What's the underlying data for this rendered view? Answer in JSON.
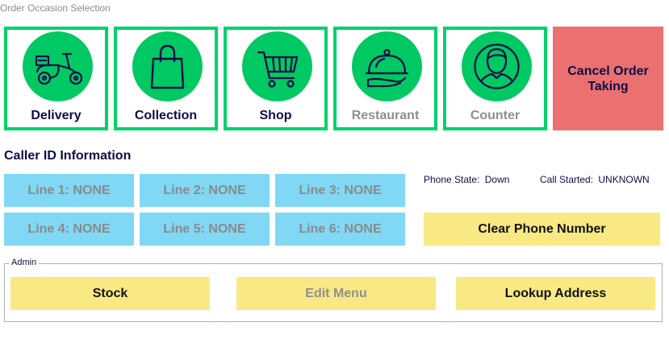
{
  "window": {
    "title": "Order Occasion Selection"
  },
  "occasions": [
    {
      "label": "Delivery",
      "icon": "scooter-icon",
      "enabled": true
    },
    {
      "label": "Collection",
      "icon": "shopping-bag-icon",
      "enabled": true
    },
    {
      "label": "Shop",
      "icon": "shopping-cart-icon",
      "enabled": true
    },
    {
      "label": "Restaurant",
      "icon": "cloche-icon",
      "enabled": false
    },
    {
      "label": "Counter",
      "icon": "person-icon",
      "enabled": false
    }
  ],
  "cancel": {
    "label": "Cancel Order Taking"
  },
  "caller_id": {
    "title": "Caller ID Information",
    "lines": [
      "Line 1:  NONE",
      "Line 2:  NONE",
      "Line 3:  NONE",
      "Line 4:  NONE",
      "Line 5:  NONE",
      "Line 6:  NONE"
    ],
    "phone_state_label": "Phone State:",
    "phone_state_value": "Down",
    "call_started_label": "Call Started:",
    "call_started_value": "UNKNOWN",
    "clear_label": "Clear Phone Number"
  },
  "admin": {
    "legend": "Admin",
    "stock_label": "Stock",
    "edit_menu_label": "Edit Menu",
    "lookup_label": "Lookup Address"
  },
  "colors": {
    "green_border": "#00d26a",
    "green_circle": "#00c862",
    "cancel": "#eb7070",
    "line_button": "#80d8f5",
    "yellow_button": "#f8e985",
    "navy_text": "#0d0d4a"
  }
}
